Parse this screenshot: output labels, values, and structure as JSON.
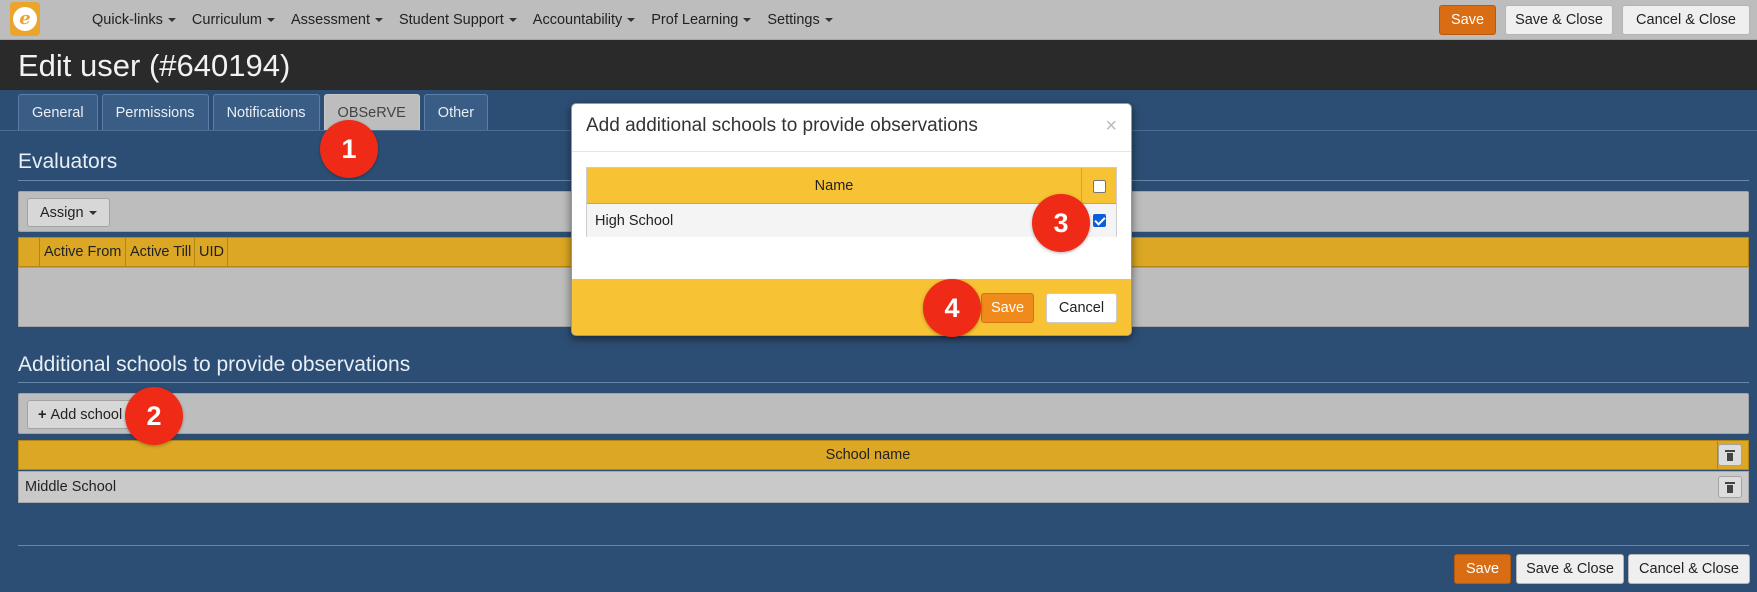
{
  "topbar": {
    "logo_letter": "e",
    "nav": [
      {
        "label": "Quick-links"
      },
      {
        "label": "Curriculum"
      },
      {
        "label": "Assessment"
      },
      {
        "label": "Student Support"
      },
      {
        "label": "Accountability"
      },
      {
        "label": "Prof Learning"
      },
      {
        "label": "Settings"
      }
    ],
    "save_label": "Save",
    "save_close_label": "Save & Close",
    "cancel_close_label": "Cancel & Close"
  },
  "page": {
    "title": "Edit user (#640194)"
  },
  "tabs": [
    {
      "label": "General",
      "active": false
    },
    {
      "label": "Permissions",
      "active": false
    },
    {
      "label": "Notifications",
      "active": false
    },
    {
      "label": "OBSeRVE",
      "active": true
    },
    {
      "label": "Other",
      "active": false
    }
  ],
  "evaluators": {
    "title": "Evaluators",
    "assign_label": "Assign",
    "columns": [
      "Active From",
      "Active Till",
      "UID"
    ]
  },
  "additional_schools": {
    "title": "Additional schools to provide observations",
    "add_label": "Add school",
    "column": "School name",
    "rows": [
      "Middle School"
    ]
  },
  "modal": {
    "title": "Add additional schools to provide observations",
    "close_glyph": "×",
    "column": "Name",
    "rows": [
      {
        "name": "High School",
        "checked": true
      }
    ],
    "save_label": "Save",
    "cancel_label": "Cancel"
  },
  "bottom": {
    "save_label": "Save",
    "save_close_label": "Save & Close",
    "cancel_close_label": "Cancel & Close"
  },
  "markers": [
    "1",
    "2",
    "3",
    "4"
  ],
  "colors": {
    "page_bg": "#2d4e74",
    "topbar_bg": "#bdbdbd",
    "orange": "#d96d13",
    "grid_header": "#dba724",
    "modal_accent": "#f7c233",
    "marker_red": "#ef2a16"
  }
}
